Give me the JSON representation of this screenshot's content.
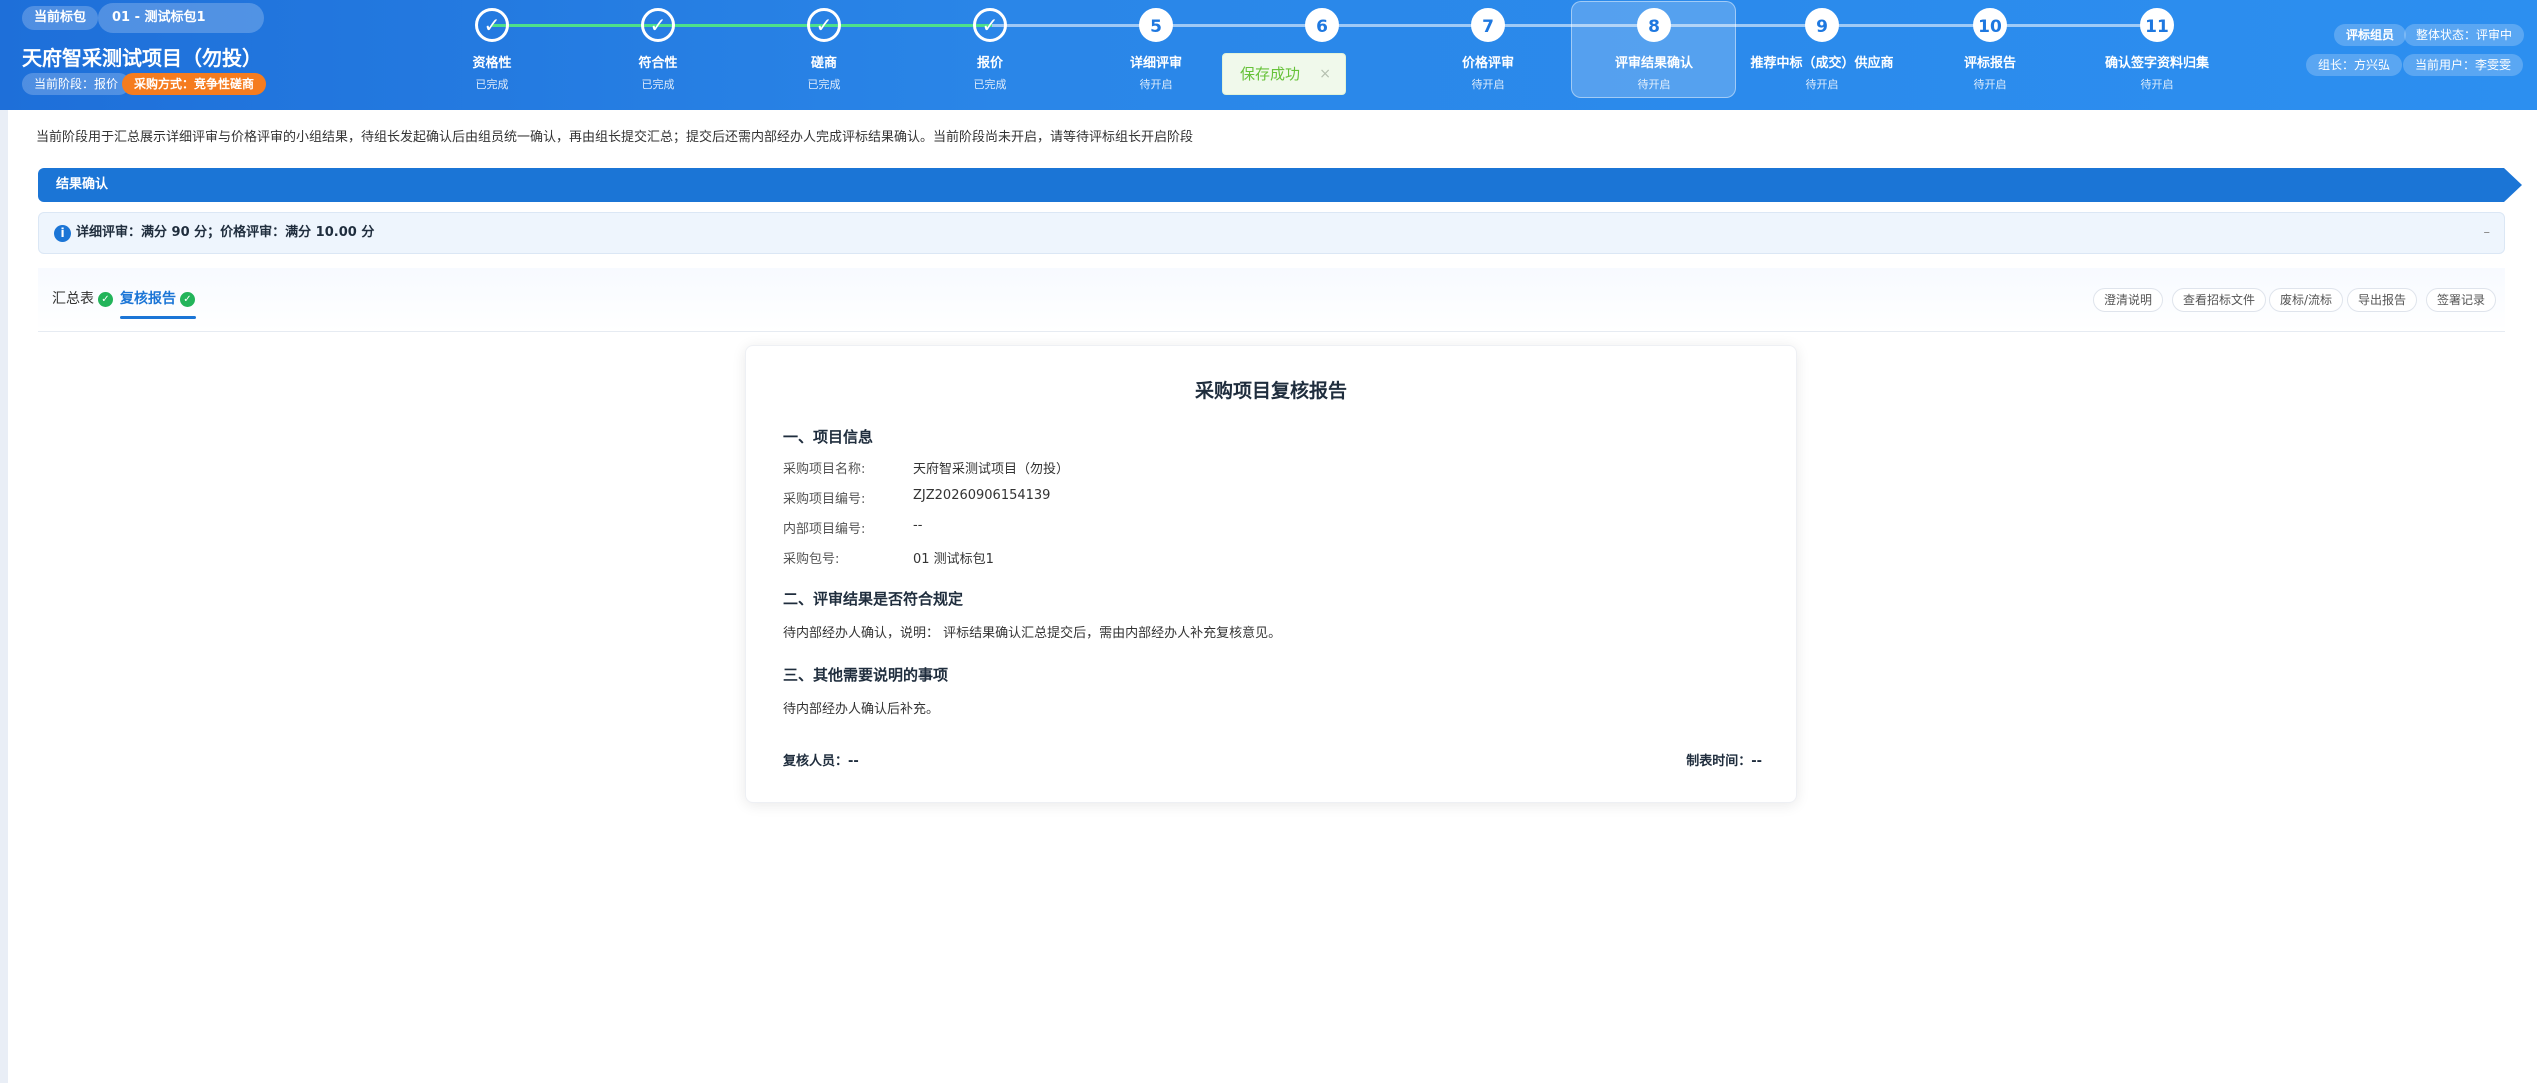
{
  "header": {
    "current_package_label": "当前标包",
    "current_package_value": "01 - 测试标包1",
    "project_title": "天府智采测试项目（勿投）",
    "stage_label": "当前阶段：报价",
    "method_label": "采购方式：竞争性磋商",
    "role_label": "评标组员",
    "overall_status": "整体状态：评审中",
    "leader": "组长：方兴弘",
    "current_user": "当前用户：李雯雯"
  },
  "steps": [
    {
      "num": "✓",
      "label": "资格性",
      "status": "已完成",
      "done": true
    },
    {
      "num": "✓",
      "label": "符合性",
      "status": "已完成",
      "done": true
    },
    {
      "num": "✓",
      "label": "磋商",
      "status": "已完成",
      "done": true
    },
    {
      "num": "✓",
      "label": "报价",
      "status": "已完成",
      "done": true
    },
    {
      "num": "5",
      "label": "详细评审",
      "status": "待开启",
      "done": false
    },
    {
      "num": "6",
      "label": "",
      "status": "",
      "done": false
    },
    {
      "num": "7",
      "label": "价格评审",
      "status": "待开启",
      "done": false
    },
    {
      "num": "8",
      "label": "评审结果确认",
      "status": "待开启",
      "done": false
    },
    {
      "num": "9",
      "label": "推荐中标（成交）供应商",
      "status": "待开启",
      "done": false
    },
    {
      "num": "10",
      "label": "评标报告",
      "status": "待开启",
      "done": false
    },
    {
      "num": "11",
      "label": "确认签字资料归集",
      "status": "待开启",
      "done": false
    }
  ],
  "toast": {
    "message": "保存成功",
    "close": "×"
  },
  "info_text": "当前阶段用于汇总展示详细评审与价格评审的小组结果，待组长发起确认后由组员统一确认，再由组长提交汇总；提交后还需内部经办人完成评标结果确认。当前阶段尚未开启，请等待评标组长开启阶段",
  "banner": "结果确认",
  "score_bar": {
    "text": "详细评审：满分 90 分；价格评审：满分 10.00 分",
    "collapse": "–"
  },
  "tabs": [
    {
      "label": "汇总表",
      "active": false
    },
    {
      "label": "复核报告",
      "active": true
    }
  ],
  "actions": [
    "澄清说明",
    "查看招标文件",
    "废标/流标",
    "导出报告",
    "签署记录"
  ],
  "report": {
    "title": "采购项目复核报告",
    "section1": "一、项目信息",
    "fields": [
      {
        "label": "采购项目名称:",
        "value": "天府智采测试项目（勿投）"
      },
      {
        "label": "采购项目编号:",
        "value": "ZJZ20260906154139"
      },
      {
        "label": "内部项目编号:",
        "value": "--"
      },
      {
        "label": "采购包号:",
        "value": "01 测试标包1"
      }
    ],
    "section2": "二、评审结果是否符合规定",
    "section2_text": "待内部经办人确认，说明： 评标结果确认汇总提交后，需由内部经办人补充复核意见。",
    "section3": "三、其他需要说明的事项",
    "section3_text": "待内部经办人确认后补充。",
    "reviewer": "复核人员：--",
    "created_time": "制表时间：--"
  }
}
